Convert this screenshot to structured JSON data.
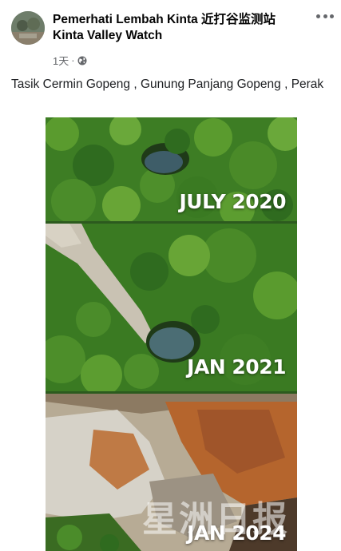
{
  "post": {
    "author_line1": "Pemerhati Lembah Kinta 近打谷监测站",
    "author_line2": "Kinta Valley Watch",
    "time": "1天",
    "separator": "·",
    "privacy_icon": "globe-icon",
    "more_icon": "more-options-icon",
    "caption": "Tasik Cermin Gopeng , Gunung Panjang Gopeng , Perak"
  },
  "photo": {
    "panels": [
      {
        "label": "JULY 2020"
      },
      {
        "label": "JAN 2021"
      },
      {
        "label": "JAN 2024"
      }
    ],
    "watermark": "星洲日报"
  },
  "colors": {
    "forest": "#2f6b1f",
    "water": "#3e5d68",
    "rock": "#c9c2b3",
    "soil": "#b5652d",
    "meta_text": "#65676b"
  }
}
